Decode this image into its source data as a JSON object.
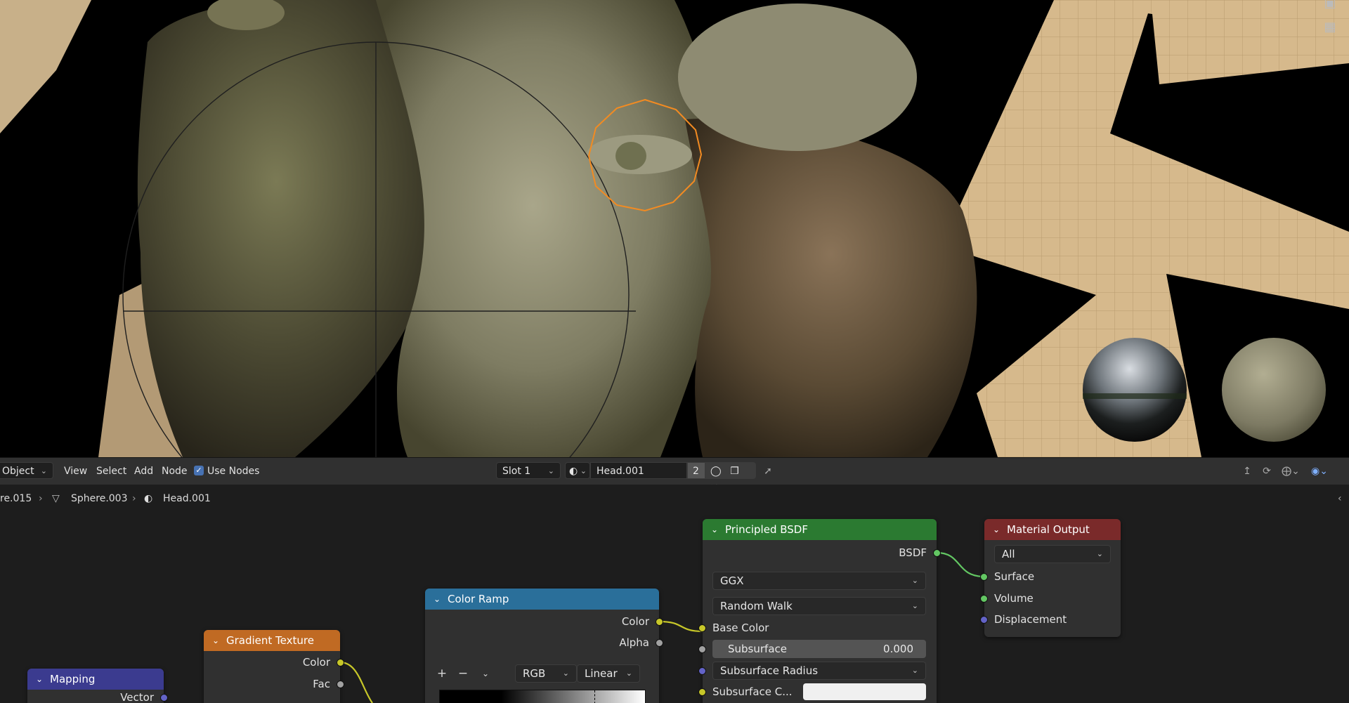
{
  "header": {
    "mode": "Object",
    "menu": [
      "View",
      "Select",
      "Add",
      "Node"
    ],
    "use_nodes_label": "Use Nodes",
    "slot": "Slot 1",
    "material_name": "Head.001",
    "user_count": "2"
  },
  "breadcrumb": {
    "object": "re.015",
    "mesh": "Sphere.003",
    "material": "Head.001"
  },
  "nodes": {
    "mapping": {
      "title": "Mapping",
      "output": "Vector",
      "color": "#3b3b8f"
    },
    "gradient": {
      "title": "Gradient Texture",
      "outputs": [
        "Color",
        "Fac"
      ],
      "color": "#c06a23"
    },
    "color_ramp": {
      "title": "Color Ramp",
      "outputs": [
        "Color",
        "Alpha"
      ],
      "mode": "RGB",
      "interpolation": "Linear",
      "color": "#2a6f9a"
    },
    "bsdf": {
      "title": "Principled BSDF",
      "output": "BSDF",
      "distribution": "GGX",
      "subsurface_method": "Random Walk",
      "inputs": [
        "Base Color",
        "Subsurface",
        "Subsurface Radius",
        "Subsurface C..."
      ],
      "subsurface_value": "0.000",
      "color": "#2b7a31"
    },
    "output": {
      "title": "Material Output",
      "target": "All",
      "inputs": [
        "Surface",
        "Volume",
        "Displacement"
      ],
      "color": "#7a2a2a"
    }
  }
}
